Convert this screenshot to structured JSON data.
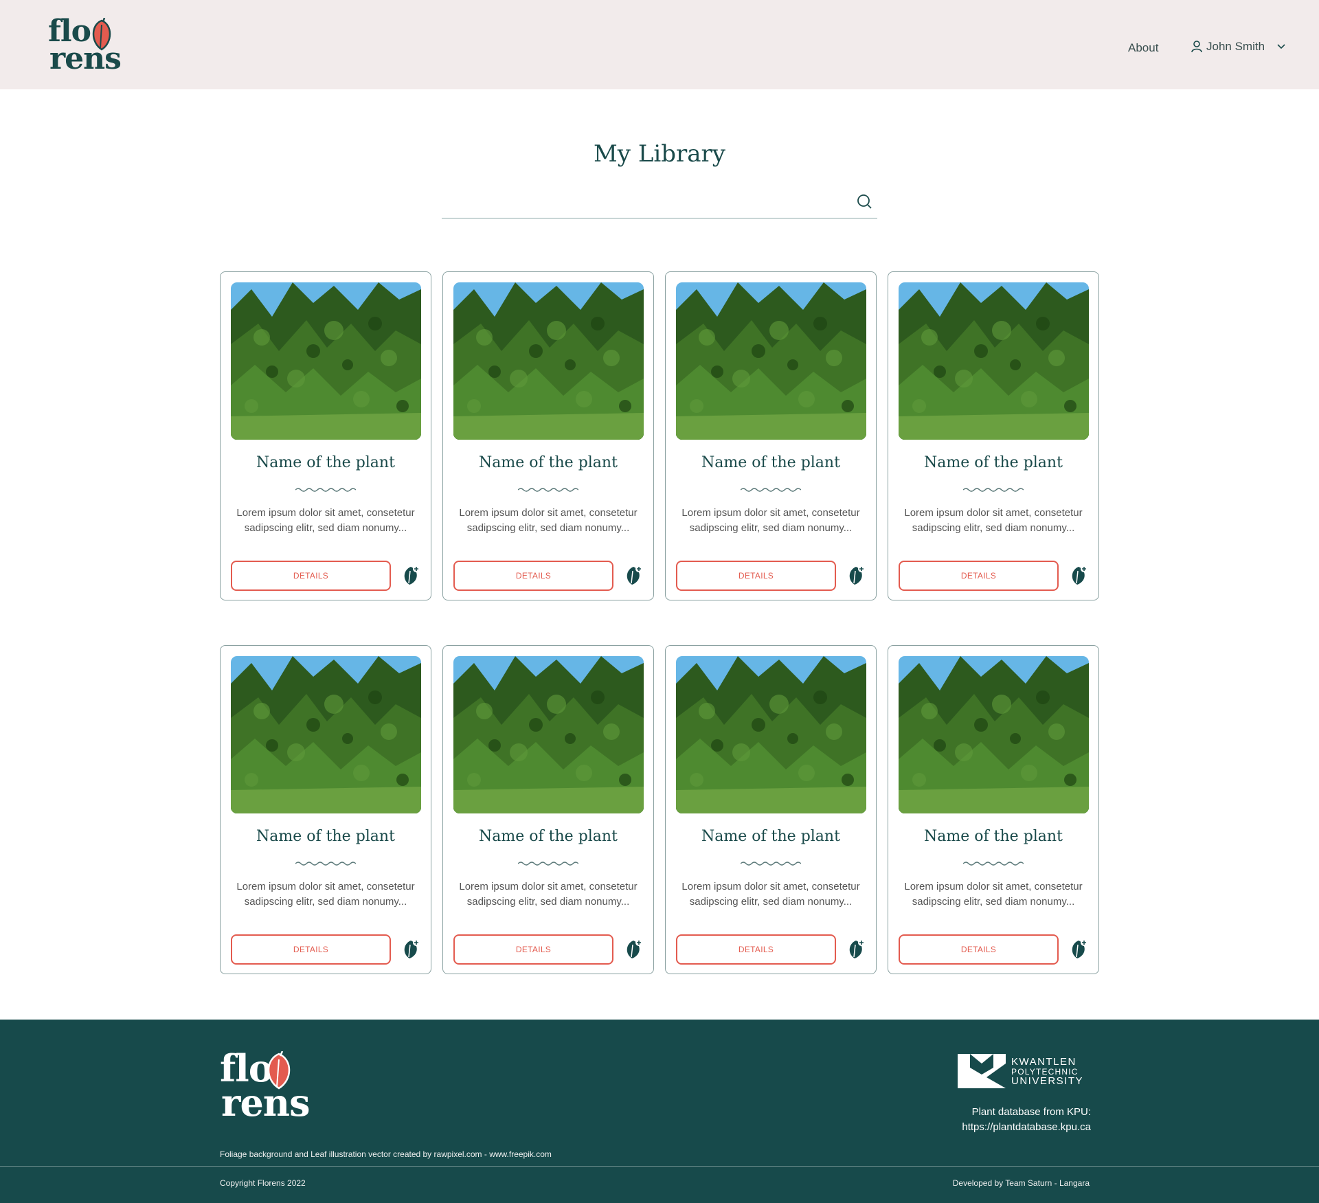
{
  "brand": {
    "logo_line1": "flo",
    "logo_line2": "rens"
  },
  "nav": {
    "about_label": "About",
    "user_name": "John Smith"
  },
  "page": {
    "title": "My Library"
  },
  "search": {
    "placeholder": "",
    "value": ""
  },
  "colors": {
    "primary": "#174a4b",
    "accent": "#e35b4f",
    "header_bg": "#f2ebeb"
  },
  "cards": [
    {
      "title": "Name of the plant",
      "description": "Lorem ipsum dolor sit amet, consetetur sadipscing elitr, sed diam nonumy...",
      "button_label": "DETAILS"
    },
    {
      "title": "Name of the plant",
      "description": "Lorem ipsum dolor sit amet, consetetur sadipscing elitr, sed diam nonumy...",
      "button_label": "DETAILS"
    },
    {
      "title": "Name of the plant",
      "description": "Lorem ipsum dolor sit amet, consetetur sadipscing elitr, sed diam nonumy...",
      "button_label": "DETAILS"
    },
    {
      "title": "Name of the plant",
      "description": "Lorem ipsum dolor sit amet, consetetur sadipscing elitr, sed diam nonumy...",
      "button_label": "DETAILS"
    },
    {
      "title": "Name of the plant",
      "description": "Lorem ipsum dolor sit amet, consetetur sadipscing elitr, sed diam nonumy...",
      "button_label": "DETAILS"
    },
    {
      "title": "Name of the plant",
      "description": "Lorem ipsum dolor sit amet, consetetur sadipscing elitr, sed diam nonumy...",
      "button_label": "DETAILS"
    },
    {
      "title": "Name of the plant",
      "description": "Lorem ipsum dolor sit amet, consetetur sadipscing elitr, sed diam nonumy...",
      "button_label": "DETAILS"
    },
    {
      "title": "Name of the plant",
      "description": "Lorem ipsum dolor sit amet, consetetur sadipscing elitr, sed diam nonumy...",
      "button_label": "DETAILS"
    }
  ],
  "footer": {
    "credit": "Foliage background and Leaf illustration vector created by rawpixel.com - www.freepik.com",
    "kpu_line1": "KWANTLEN",
    "kpu_line2": "POLYTECHNIC",
    "kpu_line3": "UNIVERSITY",
    "db_label": "Plant database from KPU:",
    "db_link": "https://plantdatabase.kpu.ca",
    "copyright": "Copyright Florens 2022",
    "developed_by": "Developed by Team Saturn - Langara"
  }
}
